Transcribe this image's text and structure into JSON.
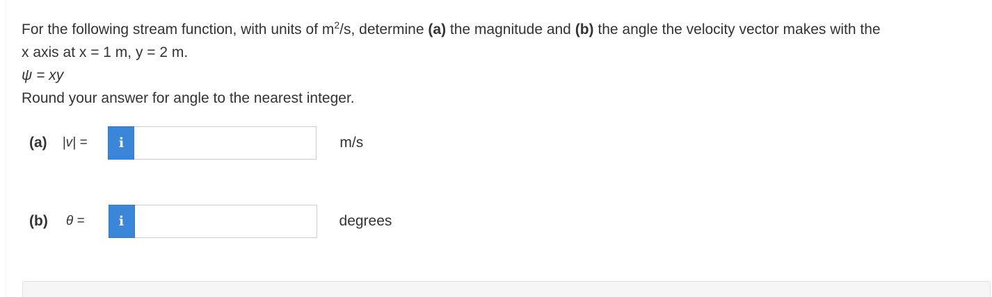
{
  "question": {
    "line1_before_a": "For the following stream function, with units of m",
    "line1_sup": "2",
    "line1_mid": "/s, determine ",
    "part_a_ref": "(a)",
    "line1_magnitude": " the magnitude and ",
    "part_b_ref": "(b)",
    "line1_after_b": " the angle the velocity vector makes with the",
    "line2": "x axis at x = 1 m, y = 2 m.",
    "equation": "ψ = xy",
    "instruction": "Round your answer for angle to the nearest integer."
  },
  "parts": {
    "a": {
      "label": "(a)",
      "variable": "|v| =",
      "info_icon": "i",
      "value": "",
      "unit": "m/s"
    },
    "b": {
      "label": "(b)",
      "variable": "θ =",
      "info_icon": "i",
      "value": "",
      "unit": "degrees"
    }
  },
  "colors": {
    "info_button": "#3b86d8",
    "text": "#333333",
    "input_border": "#cccccc",
    "panel_bg": "#f5f5f5"
  }
}
